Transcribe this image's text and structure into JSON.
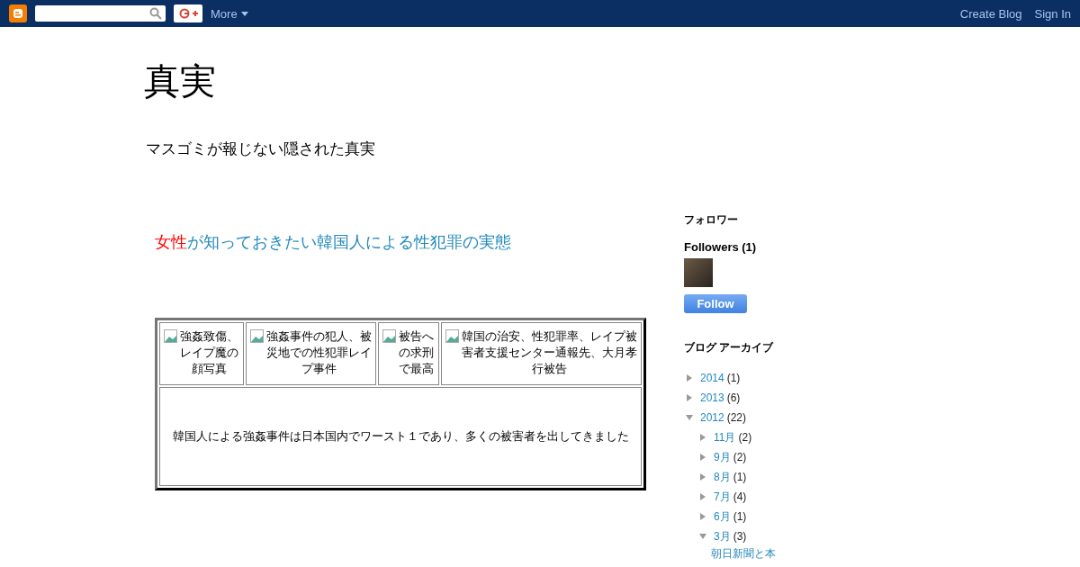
{
  "navbar": {
    "more": "More",
    "links": [
      "Create Blog",
      "Sign In"
    ]
  },
  "blog": {
    "title": "真実",
    "description": "マスゴミが報じない隠された真実"
  },
  "post": {
    "title_parts": [
      {
        "text": "女性",
        "color": "#ff0000"
      },
      {
        "text": "が知っておきたい韓国人による性犯罪の実態",
        "color": "#2288bb"
      }
    ],
    "image_cells": [
      "強姦致傷、レイプ魔の顔写真",
      "強姦事件の犯人、被災地での性犯罪レイプ事件",
      "被告への求刑で最高",
      "韓国の治安、性犯罪率、レイプ被害者支援センター通報先、大月孝行被告"
    ],
    "caption": "韓国人による強姦事件は日本国内でワースト１であり、多くの被害者を出してきました"
  },
  "followers": {
    "heading": "フォロワー",
    "count_label": "Followers (1)",
    "button": "Follow"
  },
  "archive": {
    "heading": "ブログ アーカイブ",
    "items": [
      {
        "label": "2014",
        "count": "(1)",
        "expanded": false
      },
      {
        "label": "2013",
        "count": "(6)",
        "expanded": false
      },
      {
        "label": "2012",
        "count": "(22)",
        "expanded": true,
        "children": [
          {
            "label": "11月",
            "count": "(2)",
            "expanded": false
          },
          {
            "label": "9月",
            "count": "(2)",
            "expanded": false
          },
          {
            "label": "8月",
            "count": "(1)",
            "expanded": false
          },
          {
            "label": "7月",
            "count": "(4)",
            "expanded": false
          },
          {
            "label": "6月",
            "count": "(1)",
            "expanded": false
          },
          {
            "label": "3月",
            "count": "(3)",
            "expanded": true,
            "posts": [
              "朝日新聞と本"
            ]
          }
        ]
      }
    ]
  }
}
